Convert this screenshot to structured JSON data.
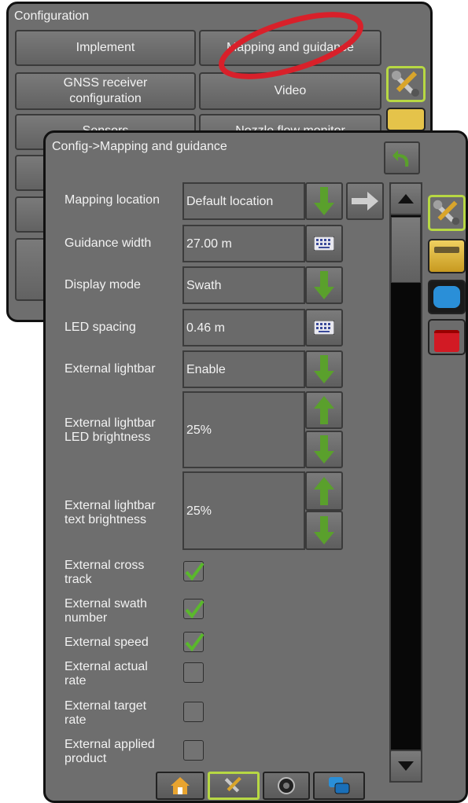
{
  "config": {
    "title": "Configuration",
    "buttons": [
      "Implement",
      "Mapping and guidance",
      "GNSS receiver configuration",
      "Video",
      "Sensors",
      "Nozzle flow monitor"
    ]
  },
  "panel": {
    "title": "Config->Mapping and guidance",
    "rows": {
      "mapping_location": {
        "label": "Mapping location",
        "value": "Default location"
      },
      "guidance_width": {
        "label": "Guidance width",
        "value": "27.00 m"
      },
      "display_mode": {
        "label": "Display mode",
        "value": "Swath"
      },
      "led_spacing": {
        "label": "LED spacing",
        "value": "0.46 m"
      },
      "external_lightbar": {
        "label": "External lightbar",
        "value": "Enable"
      },
      "led_brightness": {
        "label_line1": "External lightbar",
        "label_line2": "LED brightness",
        "value": "25%"
      },
      "text_brightness": {
        "label_line1": "External lightbar",
        "label_line2": "text brightness",
        "value": "25%"
      }
    },
    "checkboxes": [
      {
        "line1": "External cross",
        "line2": "track",
        "checked": true
      },
      {
        "line1": "External swath",
        "line2": "number",
        "checked": true
      },
      {
        "line1": "External speed",
        "line2": "",
        "checked": true
      },
      {
        "line1": "External actual",
        "line2": "rate",
        "checked": false
      },
      {
        "line1": "External target",
        "line2": "rate",
        "checked": false
      },
      {
        "line1": "External applied",
        "line2": "product",
        "checked": false
      }
    ]
  },
  "side_icons": [
    "tools-icon",
    "console-icon",
    "screen-icon",
    "toolbox-icon"
  ],
  "tabs": [
    "home-icon",
    "tools-icon",
    "camera-icon",
    "windows-icon"
  ],
  "colors": {
    "green": "#5aa02c",
    "highlight_red": "#d8202a",
    "screen_blue": "#2a8fd8"
  }
}
